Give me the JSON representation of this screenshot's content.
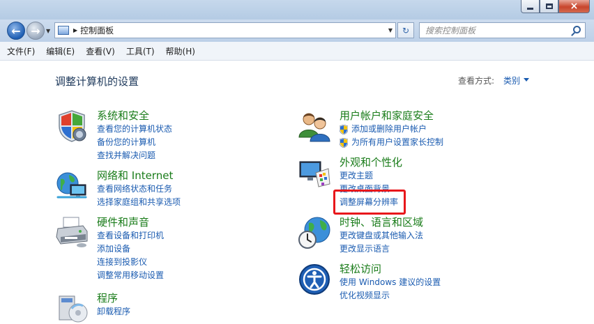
{
  "titlebar": {
    "min_label": "",
    "max_label": "",
    "close_label": "×"
  },
  "navigation": {
    "breadcrumb": "控制面板",
    "search_placeholder": "搜索控制面板"
  },
  "menu": [
    "文件(F)",
    "编辑(E)",
    "查看(V)",
    "工具(T)",
    "帮助(H)"
  ],
  "page": {
    "title": "调整计算机的设置",
    "view_by_label": "查看方式:",
    "view_by_value": "类别"
  },
  "categories": {
    "security": {
      "title": "系统和安全",
      "icon": "shield-icon",
      "links": [
        "查看您的计算机状态",
        "备份您的计算机",
        "查找并解决问题"
      ]
    },
    "network": {
      "title": "网络和 Internet",
      "icon": "network-icon",
      "links": [
        "查看网络状态和任务",
        "选择家庭组和共享选项"
      ]
    },
    "hardware": {
      "title": "硬件和声音",
      "icon": "printer-icon",
      "links": [
        "查看设备和打印机",
        "添加设备",
        "连接到投影仪",
        "调整常用移动设置"
      ]
    },
    "programs": {
      "title": "程序",
      "icon": "programs-icon",
      "links": [
        "卸载程序"
      ]
    },
    "users": {
      "title": "用户帐户和家庭安全",
      "icon": "users-icon",
      "links": [
        "添加或删除用户帐户",
        "为所有用户设置家长控制"
      ]
    },
    "appearance": {
      "title": "外观和个性化",
      "icon": "monitor-palette-icon",
      "links": [
        "更改主题",
        "更改桌面背景",
        "调整屏幕分辨率"
      ]
    },
    "clock": {
      "title": "时钟、语言和区域",
      "icon": "globe-clock-icon",
      "links": [
        "更改键盘或其他输入法",
        "更改显示语言"
      ]
    },
    "access": {
      "title": "轻松访问",
      "icon": "ease-of-access-icon",
      "links": [
        "使用 Windows 建议的设置",
        "优化视频显示"
      ]
    }
  },
  "colors": {
    "category_title": "#1a7c1a",
    "link": "#1a5bb0",
    "highlight": "#e8171b"
  }
}
